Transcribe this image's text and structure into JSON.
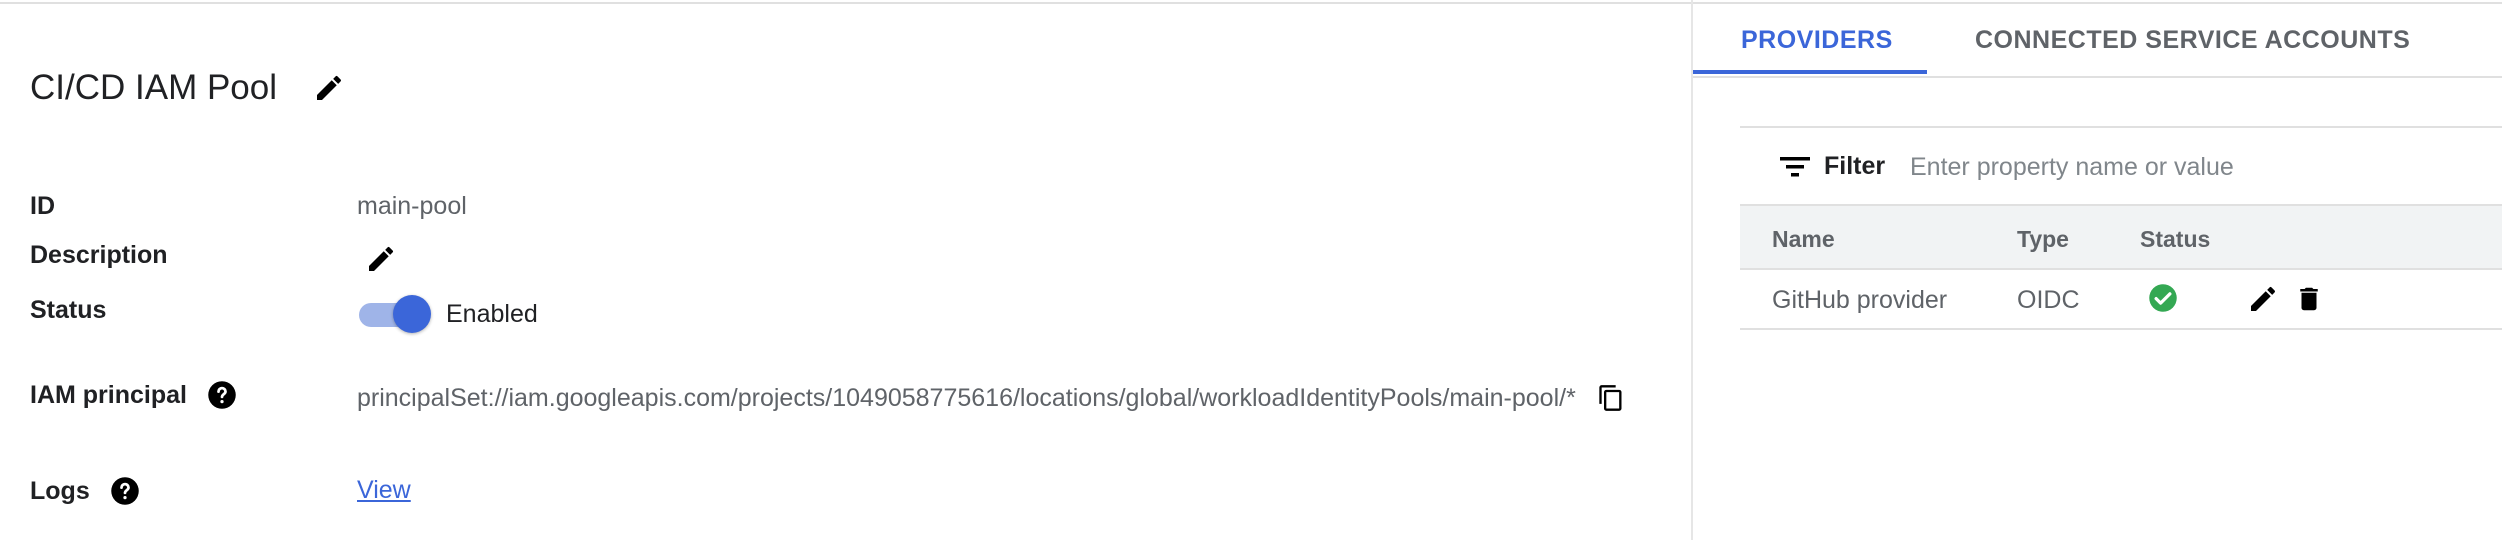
{
  "pool": {
    "title": "CI/CD IAM Pool",
    "id_label": "ID",
    "id_value": "main-pool",
    "description_label": "Description",
    "status_label": "Status",
    "status_value": "Enabled",
    "status_enabled": true,
    "principal_label": "IAM principal",
    "principal_value": "principalSet://iam.googleapis.com/projects/1049058775616/locations/global/workloadIdentityPools/main-pool/*",
    "logs_label": "Logs",
    "logs_link": "View"
  },
  "tabs": [
    {
      "label": "PROVIDERS",
      "active": true
    },
    {
      "label": "CONNECTED SERVICE ACCOUNTS",
      "active": false
    }
  ],
  "filter": {
    "label": "Filter",
    "placeholder": "Enter property name or value"
  },
  "providers_table": {
    "columns": [
      "Name",
      "Type",
      "Status"
    ],
    "rows": [
      {
        "name": "GitHub provider",
        "type": "OIDC",
        "status": "check-circle-icon"
      }
    ]
  },
  "colors": {
    "accent": "#3b66d9",
    "success": "#34a853",
    "text": "#202124",
    "muted": "#5f6368"
  },
  "icons": {
    "title_edit": "pencil-icon",
    "description_edit": "pencil-icon",
    "help": "help-circle-icon",
    "copy": "copy-icon",
    "filter": "filter-lines-icon",
    "row_edit": "pencil-icon",
    "row_delete": "trash-icon"
  }
}
